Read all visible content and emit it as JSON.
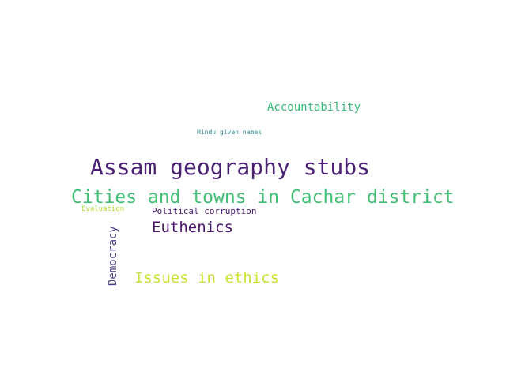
{
  "words": [
    {
      "text": "Accountability",
      "color": "#3bb67a"
    },
    {
      "text": "Hindu given names",
      "color": "#31888e"
    },
    {
      "text": "Assam geography stubs",
      "color": "#4b2273"
    },
    {
      "text": "Cities and towns in Cachar district",
      "color": "#43bf76"
    },
    {
      "text": "Evaluation",
      "color": "#b5d93a"
    },
    {
      "text": "Political corruption",
      "color": "#481b6f"
    },
    {
      "text": "Euthenics",
      "color": "#4a186d"
    },
    {
      "text": "Democracy",
      "color": "#453f87"
    },
    {
      "text": "Issues in ethics",
      "color": "#cde031"
    }
  ]
}
